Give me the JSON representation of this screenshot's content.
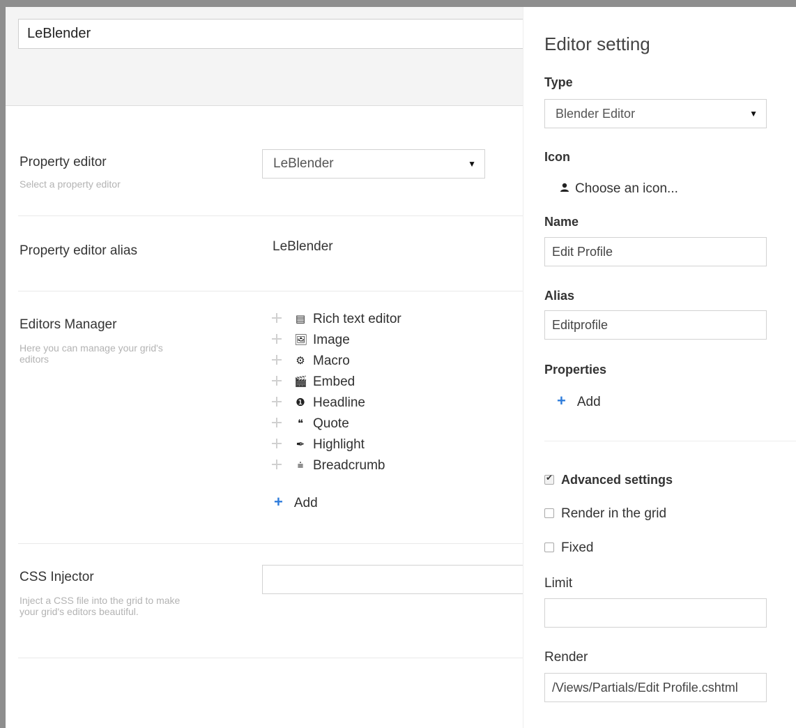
{
  "header": {
    "name_value": "LeBlender"
  },
  "property_editor": {
    "label": "Property editor",
    "description": "Select a property editor",
    "selected": "LeBlender"
  },
  "property_alias": {
    "label": "Property editor alias",
    "value": "LeBlender"
  },
  "editors_manager": {
    "label": "Editors Manager",
    "description": "Here you can manage your grid's editors",
    "items": [
      {
        "label": "Rich text editor",
        "icon": "rich-text-icon",
        "glyph": "▤"
      },
      {
        "label": "Image",
        "icon": "image-icon",
        "glyph": "🖼"
      },
      {
        "label": "Macro",
        "icon": "cogs-icon",
        "glyph": "⚙"
      },
      {
        "label": "Embed",
        "icon": "embed-icon",
        "glyph": "🎬"
      },
      {
        "label": "Headline",
        "icon": "headline-icon",
        "glyph": "❶"
      },
      {
        "label": "Quote",
        "icon": "quote-icon",
        "glyph": "❝"
      },
      {
        "label": "Highlight",
        "icon": "highlight-icon",
        "glyph": "✒"
      },
      {
        "label": "Breadcrumb",
        "icon": "breadcrumb-icon",
        "glyph": "⩧"
      }
    ],
    "add_label": "Add"
  },
  "css_injector": {
    "label": "CSS Injector",
    "description": "Inject a CSS file into the grid to make your grid's editors beautiful.",
    "value": ""
  },
  "panel": {
    "title": "Editor setting",
    "type_label": "Type",
    "type_selected": "Blender Editor",
    "icon_label": "Icon",
    "choose_icon": "Choose an icon...",
    "name_label": "Name",
    "name_value": "Edit Profile",
    "alias_label": "Alias",
    "alias_value": "Editprofile",
    "properties_label": "Properties",
    "add_label": "Add",
    "advanced_label": "Advanced settings",
    "advanced_checked": true,
    "render_grid_label": "Render in the grid",
    "render_grid_checked": false,
    "fixed_label": "Fixed",
    "fixed_checked": false,
    "limit_label": "Limit",
    "limit_value": "",
    "render_label": "Render",
    "render_value": "/Views/Partials/Edit Profile.cshtml"
  },
  "colors": {
    "accent_plus": "#2e7cdb",
    "frame": "#8e8e8e",
    "header_bg": "#f4f4f4"
  }
}
